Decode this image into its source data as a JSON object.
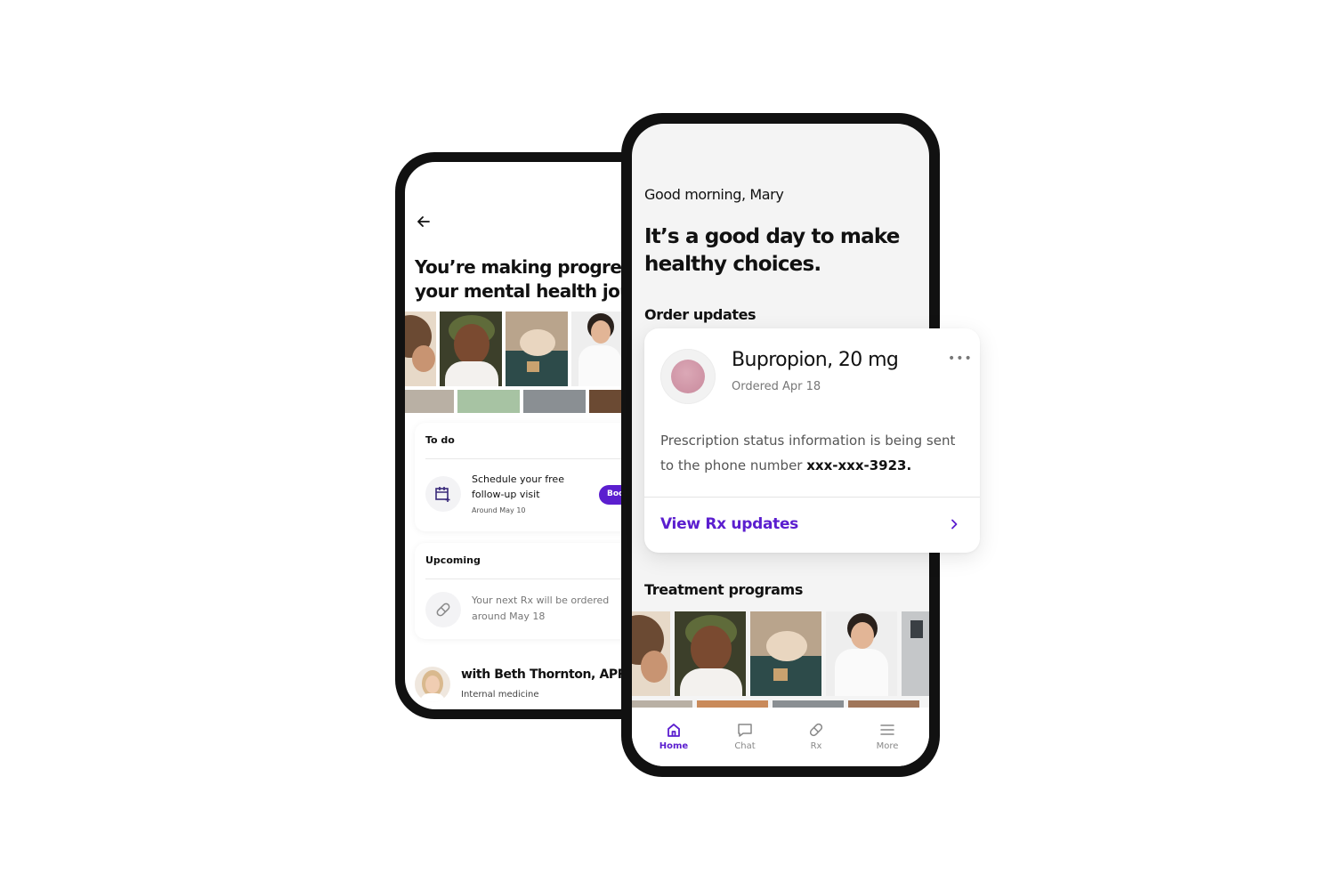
{
  "back_screen": {
    "title_line1": "You’re making progress on",
    "title_line2": "your mental health journey",
    "todo": {
      "heading": "To do",
      "item_text": "Schedule your free follow-up visit",
      "item_sub": "Around May 10",
      "button_label": "Book"
    },
    "upcoming": {
      "heading": "Upcoming",
      "item_text": "Your next Rx will be ordered around May 18"
    },
    "provider": {
      "name": "with Beth Thornton, APRN-C",
      "specialty": "Internal medicine"
    }
  },
  "front_screen": {
    "greeting": "Good morning, Mary",
    "headline": "It’s a good day to make healthy choices.",
    "order_updates_heading": "Order updates",
    "treatment_heading": "Treatment programs",
    "tabs": [
      {
        "label": "Home",
        "icon": "home-icon",
        "active": true
      },
      {
        "label": "Chat",
        "icon": "chat-icon",
        "active": false
      },
      {
        "label": "Rx",
        "icon": "pill-icon",
        "active": false
      },
      {
        "label": "More",
        "icon": "menu-icon",
        "active": false
      }
    ]
  },
  "order_card": {
    "drug_name": "Bupropion, 20 mg",
    "ordered": "Ordered Apr 18",
    "message_prefix": "Prescription status information is being sent to the phone number ",
    "phone": "xxx-xxx-3923.",
    "link_label": "View Rx updates"
  },
  "colors": {
    "accent": "#5b1ecf",
    "screen_bg": "#f4f4f4",
    "pill": "#d49aab"
  }
}
